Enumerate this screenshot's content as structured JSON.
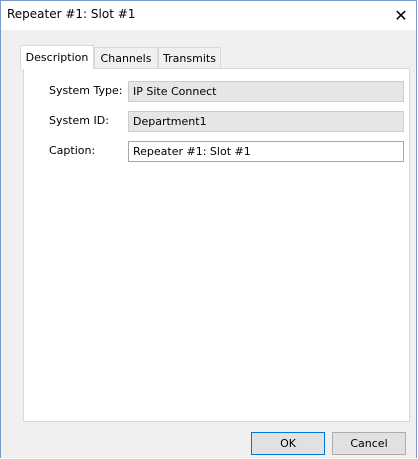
{
  "window": {
    "title": "Repeater #1: Slot #1",
    "close_glyph": "✕"
  },
  "tabs": [
    {
      "label": "Description",
      "active": true
    },
    {
      "label": "Channels",
      "active": false
    },
    {
      "label": "Transmits",
      "active": false
    }
  ],
  "fields": {
    "system_type": {
      "label": "System Type:",
      "value": "IP Site Connect",
      "readonly": true
    },
    "system_id": {
      "label": "System ID:",
      "value": "Department1",
      "readonly": true
    },
    "caption": {
      "label": "Caption:",
      "value": "Repeater #1: Slot #1",
      "readonly": false
    }
  },
  "buttons": {
    "ok": "OK",
    "cancel": "Cancel"
  }
}
